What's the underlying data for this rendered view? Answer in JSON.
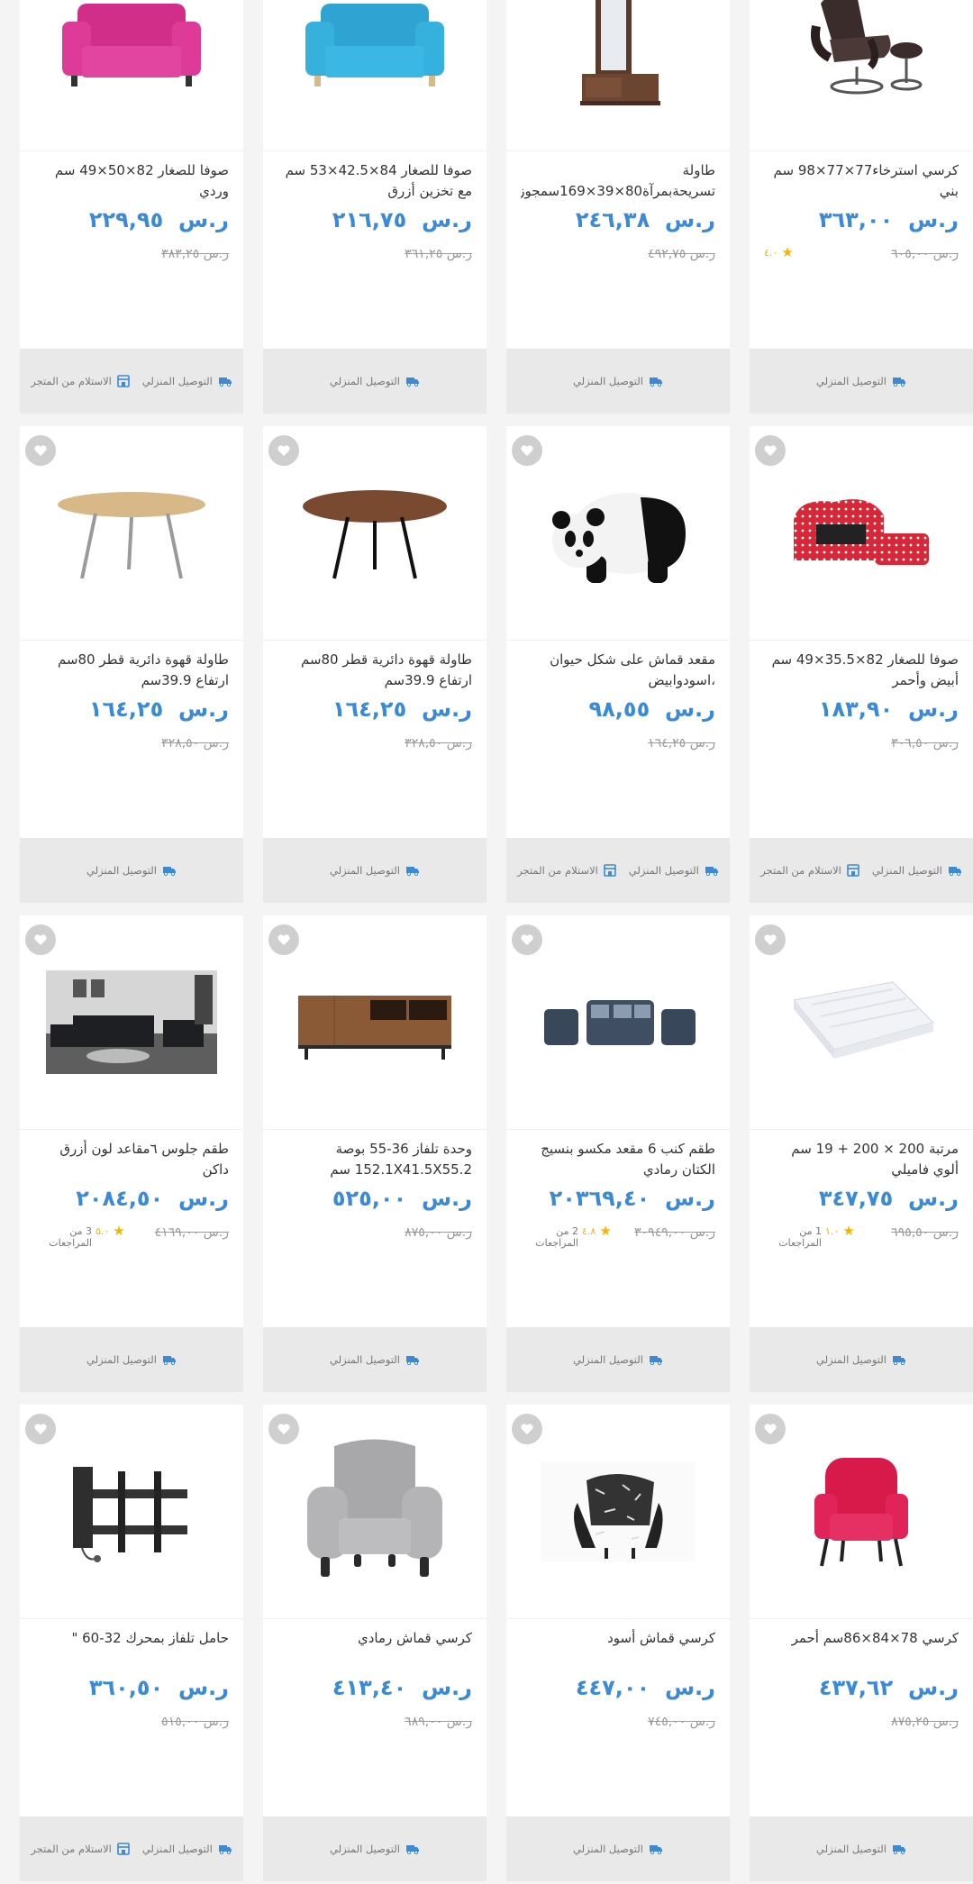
{
  "currency": "ر.س",
  "labels": {
    "home_delivery": "التوصيل المنزلي",
    "store_pickup": "الاستلام من المتجر"
  },
  "colors": {
    "price": "#3a8ad6",
    "star": "#f4b400",
    "footer_bg": "#e9e9e9"
  },
  "products": [
    {
      "title": "كرسي استرخاء77×77×98 سم بني",
      "price": "٣٦٣,٠٠",
      "old_price": "٦٠٥,٠٠",
      "rating": "٤.٠",
      "reviews": "",
      "image": "recliner-chair",
      "pickup": false
    },
    {
      "title": "طاولة تسريحةبمرآة80×39×169سمجوز",
      "price": "٢٤٦,٣٨",
      "old_price": "٤٩٢,٧٥",
      "rating": "",
      "reviews": "",
      "image": "dressing-table",
      "pickup": false
    },
    {
      "title": "صوفا للصغار 84×42.5×53 سم مع تخزين أزرق",
      "price": "٢١٦,٧٥",
      "old_price": "٣٦١,٢٥",
      "rating": "",
      "reviews": "",
      "image": "blue-kids-sofa",
      "pickup": false
    },
    {
      "title": "صوفا للصغار 82×50×49 سم وردي",
      "price": "٢٢٩,٩٥",
      "old_price": "٣٨٣,٢٥",
      "rating": "",
      "reviews": "",
      "image": "pink-kids-sofa",
      "pickup": true
    },
    {
      "title": "صوفا للصغار 82×35.5×49 سم أبيض وأحمر",
      "price": "١٨٣,٩٠",
      "old_price": "٣٠٦,٥٠",
      "rating": "",
      "reviews": "",
      "image": "red-dotted-sofa",
      "pickup": true
    },
    {
      "title": "مقعد قماش على شكل حيوان ،اسودوابيض",
      "price": "٩٨,٥٥",
      "old_price": "١٦٤,٢٥",
      "rating": "",
      "reviews": "",
      "image": "panda-stool",
      "pickup": true
    },
    {
      "title": "طاولة قهوة دائرية قطر 80سم ارتفاع 39.9سم",
      "price": "١٦٤,٢٥",
      "old_price": "٣٢٨,٥٠",
      "rating": "",
      "reviews": "",
      "image": "walnut-coffee-table",
      "pickup": false
    },
    {
      "title": "طاولة قهوة دائرية قطر 80سم ارتفاع 39.9سم",
      "price": "١٦٤,٢٥",
      "old_price": "٣٢٨,٥٠",
      "rating": "",
      "reviews": "",
      "image": "oak-coffee-table",
      "pickup": false
    },
    {
      "title": "مرتبة 200 × 200 + 19 سم ألوي فاميلي",
      "price": "٣٤٧,٧٥",
      "old_price": "٦٩٥,٥٠",
      "rating": "١.٠",
      "reviews": "1 من المراجعات",
      "image": "mattress",
      "pickup": false
    },
    {
      "title": "طقم كنب 6 مقعد مكسو بنسيج الكتان رمادي",
      "price": "٢٠٣٦٩,٤٠",
      "old_price": "٣٠٩٤٩,٠٠",
      "rating": "٤.٨",
      "reviews": "2 من المراجعات",
      "image": "sofa-set",
      "pickup": false
    },
    {
      "title": "وحدة تلفاز 36-55 بوصة 152.1X41.5X55.2 سم",
      "price": "٥٢٥,٠٠",
      "old_price": "٨٧٥,٠٠",
      "rating": "",
      "reviews": "",
      "image": "tv-unit",
      "pickup": false
    },
    {
      "title": "طقم جلوس ٦مقاعد لون أزرق داكن",
      "price": "٢٠٨٤,٥٠",
      "old_price": "٤١٦٩,٠٠",
      "rating": "٥.٠",
      "reviews": "3 من المراجعات",
      "image": "living-room",
      "pickup": false
    },
    {
      "title": "كرسي 78×84×86سم أحمر",
      "price": "٤٣٧,٦٢",
      "old_price": "٨٧٥,٢٥",
      "rating": "",
      "reviews": "",
      "image": "red-armchair",
      "pickup": false
    },
    {
      "title": "كرسي قماش أسود",
      "price": "٤٤٧,٠٠",
      "old_price": "٧٤٥,٠٠",
      "rating": "",
      "reviews": "",
      "image": "patterned-chair",
      "pickup": false
    },
    {
      "title": "كرسي قماش رمادي",
      "price": "٤١٣,٤٠",
      "old_price": "٦٨٩,٠٠",
      "rating": "",
      "reviews": "",
      "image": "grey-armchair",
      "pickup": false
    },
    {
      "title": "حامل تلفاز بمحرك 32-60 \"",
      "price": "٣٦٠,٥٠",
      "old_price": "٥١٥,٠٠",
      "rating": "",
      "reviews": "",
      "image": "tv-mount",
      "pickup": true
    }
  ]
}
